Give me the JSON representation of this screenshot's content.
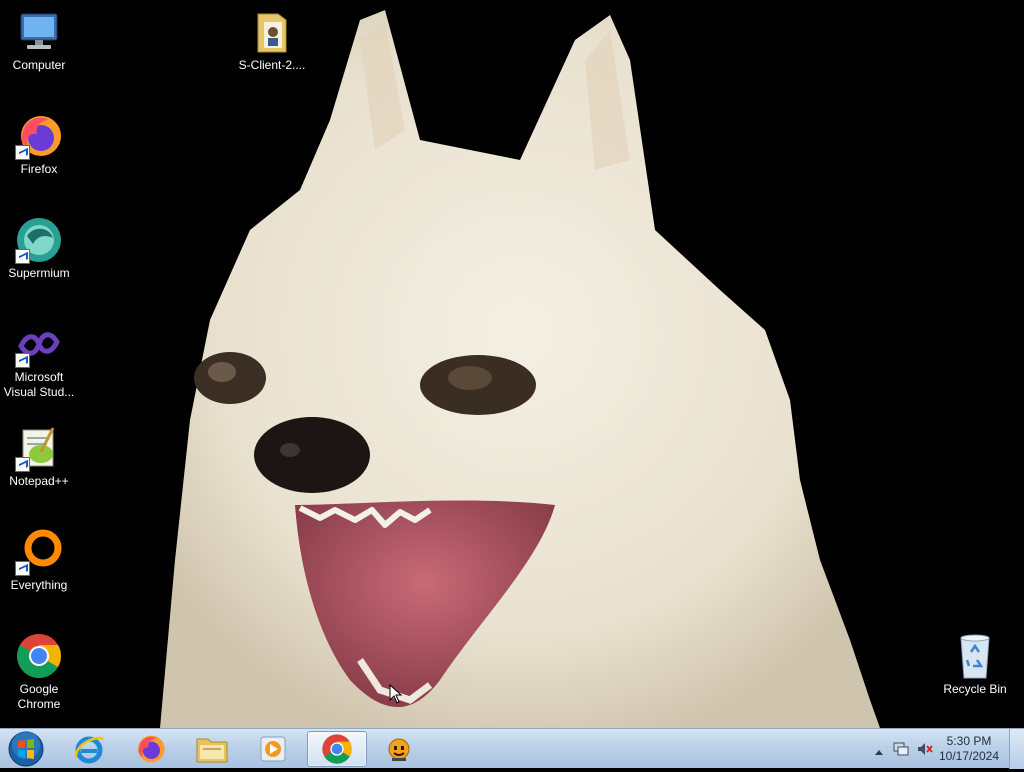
{
  "desktop": {
    "icons": [
      {
        "label": "Computer",
        "icon": "computer-icon"
      },
      {
        "label": "S-Client-2....",
        "icon": "folder-icon"
      },
      {
        "label": "Firefox",
        "icon": "firefox-icon"
      },
      {
        "label": "Supermium",
        "icon": "supermium-icon"
      },
      {
        "label": "Microsoft Visual Stud...",
        "icon": "visual-studio-icon"
      },
      {
        "label": "Notepad++",
        "icon": "notepad-plus-plus-icon"
      },
      {
        "label": "Everything",
        "icon": "everything-icon"
      },
      {
        "label": "Google Chrome",
        "icon": "chrome-icon"
      },
      {
        "label": "Recycle Bin",
        "icon": "recycle-bin-icon"
      }
    ]
  },
  "taskbar": {
    "pinned": [
      {
        "name": "internet-explorer",
        "icon": "internet-explorer-icon",
        "active": false
      },
      {
        "name": "firefox",
        "icon": "firefox-icon",
        "active": false
      },
      {
        "name": "file-explorer",
        "icon": "file-explorer-icon",
        "active": false
      },
      {
        "name": "media-player",
        "icon": "media-player-icon",
        "active": false
      },
      {
        "name": "chrome",
        "icon": "chrome-icon",
        "active": true
      },
      {
        "name": "app",
        "icon": "smiley-app-icon",
        "active": false
      }
    ],
    "tray": {
      "time": "5:30 PM",
      "date": "10/17/2024"
    }
  }
}
